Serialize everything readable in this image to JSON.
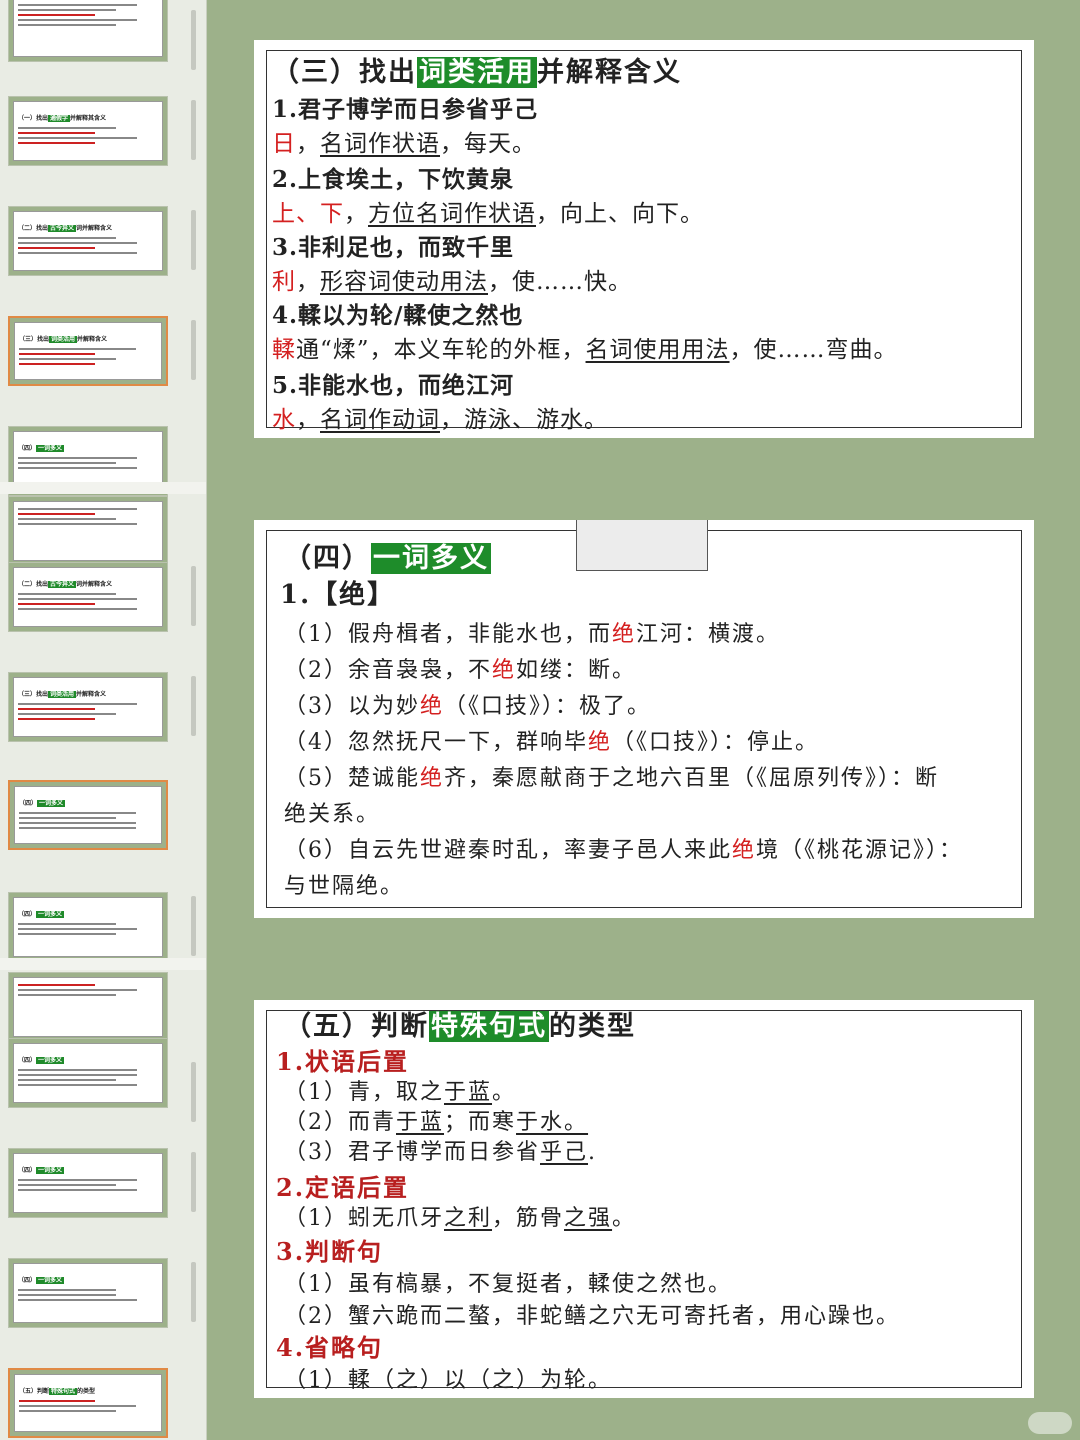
{
  "rail": {
    "thumbs": [
      {
        "title": "",
        "highlight": ""
      },
      {
        "title": "（一）找出",
        "highlight": "通假字",
        "tail": "并解释其含义"
      },
      {
        "title": "（二）找出",
        "highlight": "古今异义",
        "tail": "词并解释含义"
      },
      {
        "title": "（三）找出",
        "highlight": "词类活用",
        "tail": "并解释含义"
      },
      {
        "title": "（四）",
        "highlight": "一词多义",
        "tail": ""
      },
      {
        "title": "（二）找出",
        "highlight": "古今异义",
        "tail": "词并解释含义"
      },
      {
        "title": "（三）找出",
        "highlight": "词类活用",
        "tail": "并解释含义"
      },
      {
        "title": "（四）",
        "highlight": "一词多义",
        "tail": ""
      },
      {
        "title": "（四）",
        "highlight": "一词多义",
        "tail": ""
      },
      {
        "title": "（四）",
        "highlight": "一词多义",
        "tail": ""
      },
      {
        "title": "（四）",
        "highlight": "一词多义",
        "tail": ""
      },
      {
        "title": "（四）",
        "highlight": "一词多义",
        "tail": ""
      },
      {
        "title": "（五）判断",
        "highlight": "特殊句式",
        "tail": "的类型"
      }
    ]
  },
  "slide1": {
    "title_pre": "（三）找出",
    "title_hl": "词类活用",
    "title_post": "并解释含义",
    "items": [
      {
        "q": "1.君子博学而日参省乎己",
        "a_key": "日",
        "a_sep": "，",
        "a_type": "名词作状语",
        "a_rest": "，每天。"
      },
      {
        "q": "2.上食埃土，下饮黄泉",
        "a_key": "上、下",
        "a_sep": "，",
        "a_type": "方位名词作状语",
        "a_rest": "，向上、向下。"
      },
      {
        "q": "3.非利足也，而致千里",
        "a_key": "利",
        "a_sep": "，",
        "a_type": "形容词使动用法",
        "a_rest": "，使……快。"
      },
      {
        "q": "4.輮以为轮/輮使之然也",
        "a_key": "輮",
        "a_sep": "通“煣”，本义车轮的外框，",
        "a_type": "名词使用用法",
        "a_rest": "，使……弯曲。"
      },
      {
        "q": "5.非能水也，而绝江河",
        "a_key": "水",
        "a_sep": "，",
        "a_type": "名词作动词",
        "a_rest": "，游泳、游水。"
      }
    ]
  },
  "slide2": {
    "title_pre": "（四）",
    "title_hl": "一词多义",
    "word": "1.【绝】",
    "items": [
      {
        "pre": "（1）假舟楫者，非能水也，而",
        "key": "绝",
        "post": "江河：横渡。"
      },
      {
        "pre": "（2）余音袅袅，不",
        "key": "绝",
        "post": "如缕：断。"
      },
      {
        "pre": "（3）以为妙",
        "key": "绝",
        "post": "（《口技》）：极了。"
      },
      {
        "pre": "（4）忽然抚尺一下，群响毕",
        "key": "绝",
        "post": "（《口技》）：停止。"
      },
      {
        "pre": "（5）楚诚能",
        "key": "绝",
        "post": "齐，秦愿献商于之地六百里（《屈原列传》）：断"
      },
      {
        "pre": "绝关系。",
        "key": "",
        "post": ""
      },
      {
        "pre": "（6）自云先世避秦时乱，率妻子邑人来此",
        "key": "绝",
        "post": "境（《桃花源记》）："
      },
      {
        "pre": "与世隔绝。",
        "key": "",
        "post": ""
      }
    ]
  },
  "slide3": {
    "title_pre": "（五）判断",
    "title_hl": "特殊句式",
    "title_post": "的类型",
    "groups": [
      {
        "cat": "1.状语后置",
        "items": [
          {
            "pre": "（1）青，取之",
            "u": "于蓝",
            "post": "。"
          },
          {
            "pre": "（2）而青",
            "u": "于蓝",
            "post": "；而寒",
            "u2": "于水。",
            "post2": ""
          },
          {
            "pre": "（3）君子博学而日参省",
            "u": "乎己",
            "post": "."
          }
        ]
      },
      {
        "cat": "2.定语后置",
        "items": [
          {
            "pre": "（1）蚓无爪牙",
            "u": "之利",
            "post": "，筋骨",
            "u2": "之强",
            "post2": "。"
          }
        ]
      },
      {
        "cat": "3.判断句",
        "items": [
          {
            "pre": "（1）虽有槁暴，不复挺者，輮使之然也。",
            "u": "",
            "post": ""
          },
          {
            "pre": "（2）蟹六跪而二螯，非蛇鳝之穴无可寄托者，用心躁也。",
            "u": "",
            "post": ""
          }
        ]
      },
      {
        "cat": "4.省略句",
        "items": [
          {
            "pre": "（1）輮（之）以（之）为轮。",
            "u": "",
            "post": ""
          }
        ]
      }
    ]
  }
}
